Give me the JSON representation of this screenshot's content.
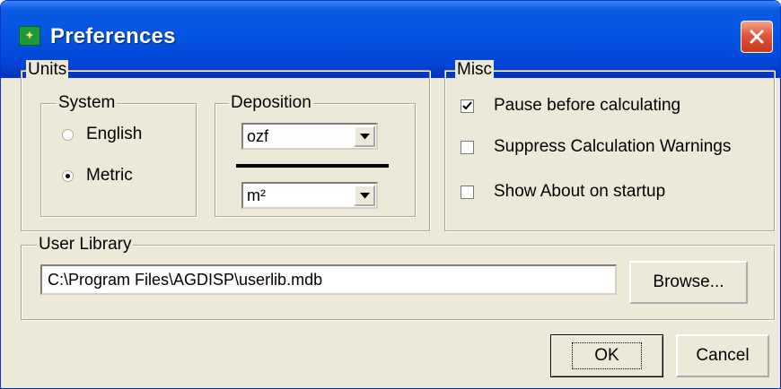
{
  "window": {
    "title": "Preferences"
  },
  "units": {
    "label": "Units",
    "system": {
      "label": "System",
      "options": [
        {
          "label": "English",
          "checked": false
        },
        {
          "label": "Metric",
          "checked": true
        }
      ]
    },
    "deposition": {
      "label": "Deposition",
      "numerator": "ozf",
      "denominator": "m²"
    }
  },
  "misc": {
    "label": "Misc",
    "options": [
      {
        "label": "Pause before calculating",
        "checked": true
      },
      {
        "label": "Suppress Calculation Warnings",
        "checked": false
      },
      {
        "label": "Show About on startup",
        "checked": false
      }
    ]
  },
  "user_library": {
    "label": "User Library",
    "path": "C:\\Program Files\\AGDISP\\userlib.mdb",
    "browse_label": "Browse..."
  },
  "buttons": {
    "ok": "OK",
    "cancel": "Cancel"
  },
  "colors": {
    "titlebar": "#0454e3",
    "close": "#e0563a",
    "face": "#ece9d8"
  }
}
